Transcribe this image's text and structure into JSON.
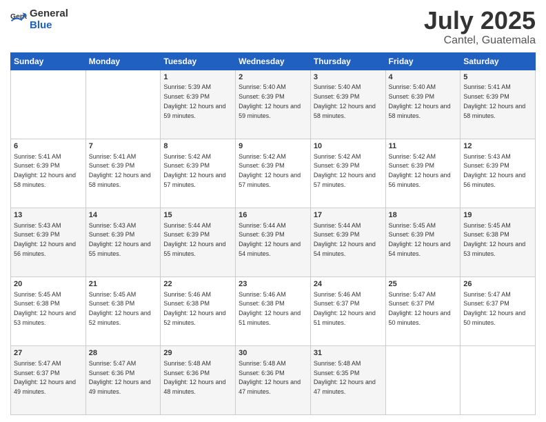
{
  "header": {
    "logo_general": "General",
    "logo_blue": "Blue",
    "title": "July 2025",
    "subtitle": "Cantel, Guatemala"
  },
  "weekdays": [
    "Sunday",
    "Monday",
    "Tuesday",
    "Wednesday",
    "Thursday",
    "Friday",
    "Saturday"
  ],
  "weeks": [
    [
      {
        "day": "",
        "sunrise": "",
        "sunset": "",
        "daylight": ""
      },
      {
        "day": "",
        "sunrise": "",
        "sunset": "",
        "daylight": ""
      },
      {
        "day": "1",
        "sunrise": "Sunrise: 5:39 AM",
        "sunset": "Sunset: 6:39 PM",
        "daylight": "Daylight: 12 hours and 59 minutes."
      },
      {
        "day": "2",
        "sunrise": "Sunrise: 5:40 AM",
        "sunset": "Sunset: 6:39 PM",
        "daylight": "Daylight: 12 hours and 59 minutes."
      },
      {
        "day": "3",
        "sunrise": "Sunrise: 5:40 AM",
        "sunset": "Sunset: 6:39 PM",
        "daylight": "Daylight: 12 hours and 58 minutes."
      },
      {
        "day": "4",
        "sunrise": "Sunrise: 5:40 AM",
        "sunset": "Sunset: 6:39 PM",
        "daylight": "Daylight: 12 hours and 58 minutes."
      },
      {
        "day": "5",
        "sunrise": "Sunrise: 5:41 AM",
        "sunset": "Sunset: 6:39 PM",
        "daylight": "Daylight: 12 hours and 58 minutes."
      }
    ],
    [
      {
        "day": "6",
        "sunrise": "Sunrise: 5:41 AM",
        "sunset": "Sunset: 6:39 PM",
        "daylight": "Daylight: 12 hours and 58 minutes."
      },
      {
        "day": "7",
        "sunrise": "Sunrise: 5:41 AM",
        "sunset": "Sunset: 6:39 PM",
        "daylight": "Daylight: 12 hours and 58 minutes."
      },
      {
        "day": "8",
        "sunrise": "Sunrise: 5:42 AM",
        "sunset": "Sunset: 6:39 PM",
        "daylight": "Daylight: 12 hours and 57 minutes."
      },
      {
        "day": "9",
        "sunrise": "Sunrise: 5:42 AM",
        "sunset": "Sunset: 6:39 PM",
        "daylight": "Daylight: 12 hours and 57 minutes."
      },
      {
        "day": "10",
        "sunrise": "Sunrise: 5:42 AM",
        "sunset": "Sunset: 6:39 PM",
        "daylight": "Daylight: 12 hours and 57 minutes."
      },
      {
        "day": "11",
        "sunrise": "Sunrise: 5:42 AM",
        "sunset": "Sunset: 6:39 PM",
        "daylight": "Daylight: 12 hours and 56 minutes."
      },
      {
        "day": "12",
        "sunrise": "Sunrise: 5:43 AM",
        "sunset": "Sunset: 6:39 PM",
        "daylight": "Daylight: 12 hours and 56 minutes."
      }
    ],
    [
      {
        "day": "13",
        "sunrise": "Sunrise: 5:43 AM",
        "sunset": "Sunset: 6:39 PM",
        "daylight": "Daylight: 12 hours and 56 minutes."
      },
      {
        "day": "14",
        "sunrise": "Sunrise: 5:43 AM",
        "sunset": "Sunset: 6:39 PM",
        "daylight": "Daylight: 12 hours and 55 minutes."
      },
      {
        "day": "15",
        "sunrise": "Sunrise: 5:44 AM",
        "sunset": "Sunset: 6:39 PM",
        "daylight": "Daylight: 12 hours and 55 minutes."
      },
      {
        "day": "16",
        "sunrise": "Sunrise: 5:44 AM",
        "sunset": "Sunset: 6:39 PM",
        "daylight": "Daylight: 12 hours and 54 minutes."
      },
      {
        "day": "17",
        "sunrise": "Sunrise: 5:44 AM",
        "sunset": "Sunset: 6:39 PM",
        "daylight": "Daylight: 12 hours and 54 minutes."
      },
      {
        "day": "18",
        "sunrise": "Sunrise: 5:45 AM",
        "sunset": "Sunset: 6:39 PM",
        "daylight": "Daylight: 12 hours and 54 minutes."
      },
      {
        "day": "19",
        "sunrise": "Sunrise: 5:45 AM",
        "sunset": "Sunset: 6:38 PM",
        "daylight": "Daylight: 12 hours and 53 minutes."
      }
    ],
    [
      {
        "day": "20",
        "sunrise": "Sunrise: 5:45 AM",
        "sunset": "Sunset: 6:38 PM",
        "daylight": "Daylight: 12 hours and 53 minutes."
      },
      {
        "day": "21",
        "sunrise": "Sunrise: 5:45 AM",
        "sunset": "Sunset: 6:38 PM",
        "daylight": "Daylight: 12 hours and 52 minutes."
      },
      {
        "day": "22",
        "sunrise": "Sunrise: 5:46 AM",
        "sunset": "Sunset: 6:38 PM",
        "daylight": "Daylight: 12 hours and 52 minutes."
      },
      {
        "day": "23",
        "sunrise": "Sunrise: 5:46 AM",
        "sunset": "Sunset: 6:38 PM",
        "daylight": "Daylight: 12 hours and 51 minutes."
      },
      {
        "day": "24",
        "sunrise": "Sunrise: 5:46 AM",
        "sunset": "Sunset: 6:37 PM",
        "daylight": "Daylight: 12 hours and 51 minutes."
      },
      {
        "day": "25",
        "sunrise": "Sunrise: 5:47 AM",
        "sunset": "Sunset: 6:37 PM",
        "daylight": "Daylight: 12 hours and 50 minutes."
      },
      {
        "day": "26",
        "sunrise": "Sunrise: 5:47 AM",
        "sunset": "Sunset: 6:37 PM",
        "daylight": "Daylight: 12 hours and 50 minutes."
      }
    ],
    [
      {
        "day": "27",
        "sunrise": "Sunrise: 5:47 AM",
        "sunset": "Sunset: 6:37 PM",
        "daylight": "Daylight: 12 hours and 49 minutes."
      },
      {
        "day": "28",
        "sunrise": "Sunrise: 5:47 AM",
        "sunset": "Sunset: 6:36 PM",
        "daylight": "Daylight: 12 hours and 49 minutes."
      },
      {
        "day": "29",
        "sunrise": "Sunrise: 5:48 AM",
        "sunset": "Sunset: 6:36 PM",
        "daylight": "Daylight: 12 hours and 48 minutes."
      },
      {
        "day": "30",
        "sunrise": "Sunrise: 5:48 AM",
        "sunset": "Sunset: 6:36 PM",
        "daylight": "Daylight: 12 hours and 47 minutes."
      },
      {
        "day": "31",
        "sunrise": "Sunrise: 5:48 AM",
        "sunset": "Sunset: 6:35 PM",
        "daylight": "Daylight: 12 hours and 47 minutes."
      },
      {
        "day": "",
        "sunrise": "",
        "sunset": "",
        "daylight": ""
      },
      {
        "day": "",
        "sunrise": "",
        "sunset": "",
        "daylight": ""
      }
    ]
  ]
}
